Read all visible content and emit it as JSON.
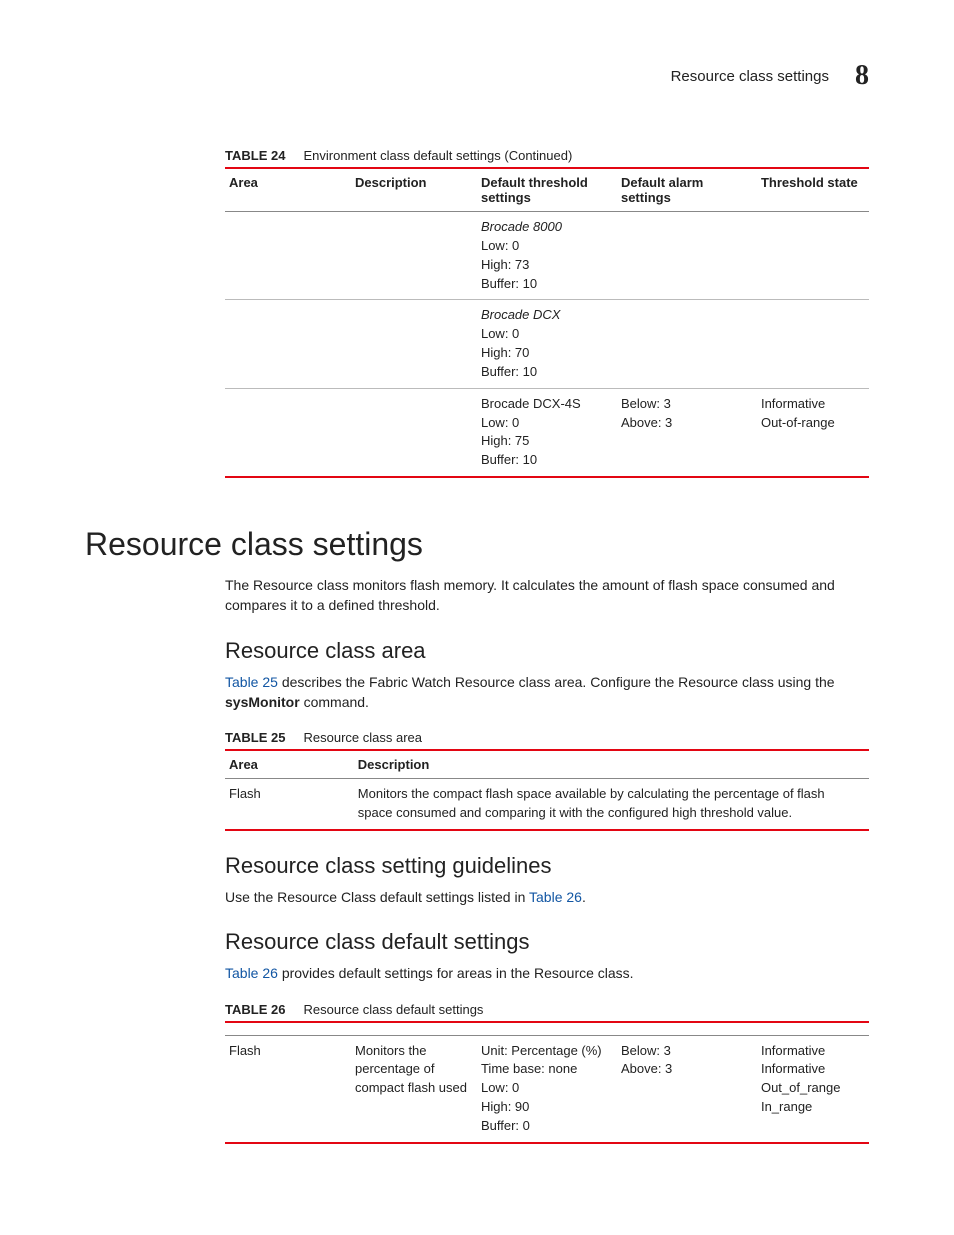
{
  "header": {
    "running_title": "Resource class settings",
    "chapter": "8"
  },
  "table24": {
    "caption_label": "TABLE 24",
    "caption_text": "Environment class default settings (Continued)",
    "columns": [
      "Area",
      "Description",
      "Default threshold settings",
      "Default alarm settings",
      "Threshold state"
    ],
    "rows": [
      {
        "area": "",
        "desc": "",
        "threshold": "Brocade 8000\nLow: 0\nHigh: 73\nBuffer: 10",
        "alarm": "",
        "state": "",
        "threshold_ital_first": true,
        "row_border": false
      },
      {
        "area": "",
        "desc": "",
        "threshold": "Brocade DCX\nLow: 0\nHigh: 70\nBuffer: 10",
        "alarm": "",
        "state": "",
        "threshold_ital_first": true,
        "row_border": true
      },
      {
        "area": "",
        "desc": "",
        "threshold": "Brocade DCX-4S\nLow: 0\nHigh: 75\nBuffer: 10",
        "alarm": "Below: 3\nAbove: 3",
        "state": "Informative\nOut-of-range",
        "threshold_ital_first": false,
        "row_border": true
      }
    ]
  },
  "section": {
    "heading": "Resource class settings",
    "intro": "The Resource class monitors flash memory. It calculates the amount of flash space consumed and compares it to a defined threshold.",
    "area_heading": "Resource class area",
    "area_para_pre": "",
    "area_para_link": "Table 25",
    "area_para_mid": " describes the Fabric Watch Resource class area. Configure the Resource class using the ",
    "area_para_cmd": "sysMonitor",
    "area_para_post": " command.",
    "table25": {
      "caption_label": "TABLE 25",
      "caption_text": "Resource class area",
      "columns": [
        "Area",
        "Description"
      ],
      "row": {
        "area": "Flash",
        "desc": "Monitors the compact flash space available by calculating the percentage of flash space consumed and comparing it with the configured high threshold value."
      }
    },
    "guidelines_heading": "Resource class setting guidelines",
    "guidelines_para_pre": "Use the Resource Class default settings listed in ",
    "guidelines_para_link": "Table 26",
    "guidelines_para_post": ".",
    "defaults_heading": "Resource class default settings",
    "defaults_para_link": "Table 26",
    "defaults_para_post": " provides default settings for areas in the Resource class.",
    "table26": {
      "caption_label": "TABLE 26",
      "caption_text": "Resource class default settings",
      "row": {
        "area": "Flash",
        "desc": "Monitors the percentage of compact flash used",
        "threshold": "Unit: Percentage (%)\nTime base: none\nLow: 0\nHigh: 90\nBuffer: 0",
        "alarm": "Below: 3\nAbove: 3",
        "state": "Informative\nInformative\nOut_of_range\nIn_range"
      }
    }
  }
}
